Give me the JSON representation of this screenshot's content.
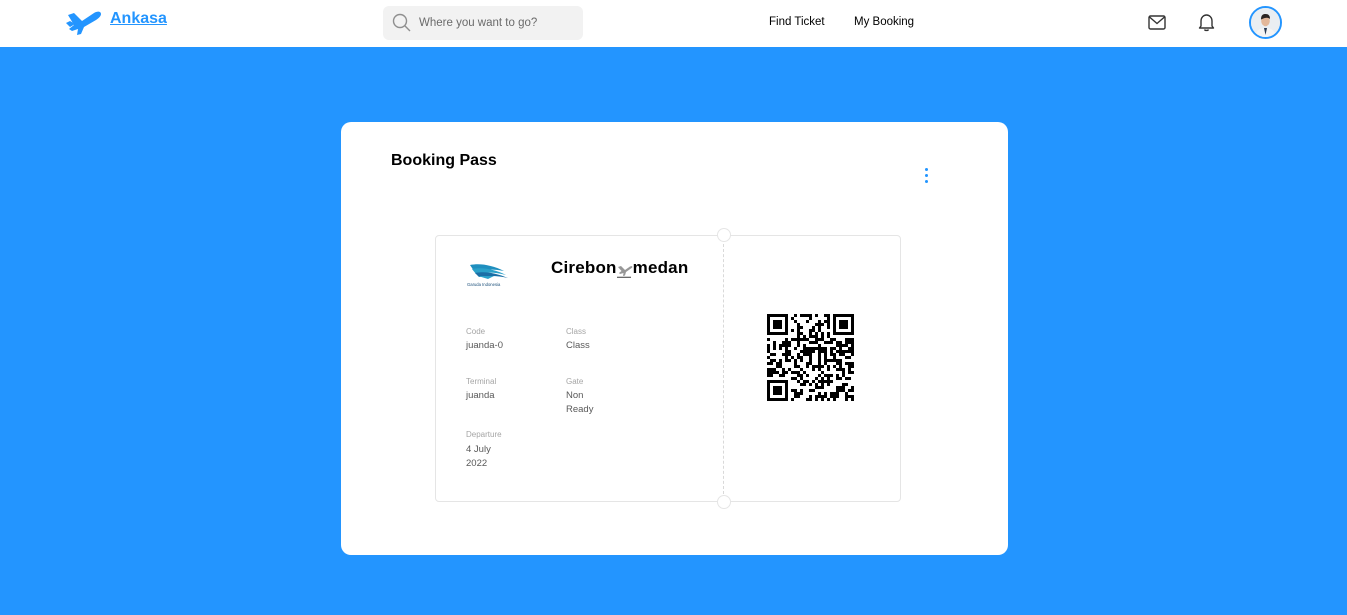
{
  "brand": {
    "name": "Ankasa",
    "color": "#2395FF"
  },
  "search": {
    "placeholder": "Where you want to go?"
  },
  "nav": {
    "find_ticket": "Find Ticket",
    "my_booking": "My Booking"
  },
  "icons": {
    "mail": "mail-icon",
    "bell": "bell-icon",
    "search": "search-icon",
    "menu": "kebab-menu-icon"
  },
  "page": {
    "background": "#2395FF"
  },
  "booking": {
    "title": "Booking Pass",
    "airline_caption": "Garuda Indonesia",
    "route": {
      "from": "Cirebon",
      "to": "medan"
    },
    "fields": {
      "code": {
        "label": "Code",
        "value": "juanda-0"
      },
      "class": {
        "label": "Class",
        "value": "Class"
      },
      "terminal": {
        "label": "Terminal",
        "value": "juanda"
      },
      "gate": {
        "label": "Gate",
        "value_line1": "Non",
        "value_line2": "Ready"
      },
      "departure": {
        "label": "Departure",
        "value_line1": "4 July",
        "value_line2": "2022"
      }
    }
  }
}
